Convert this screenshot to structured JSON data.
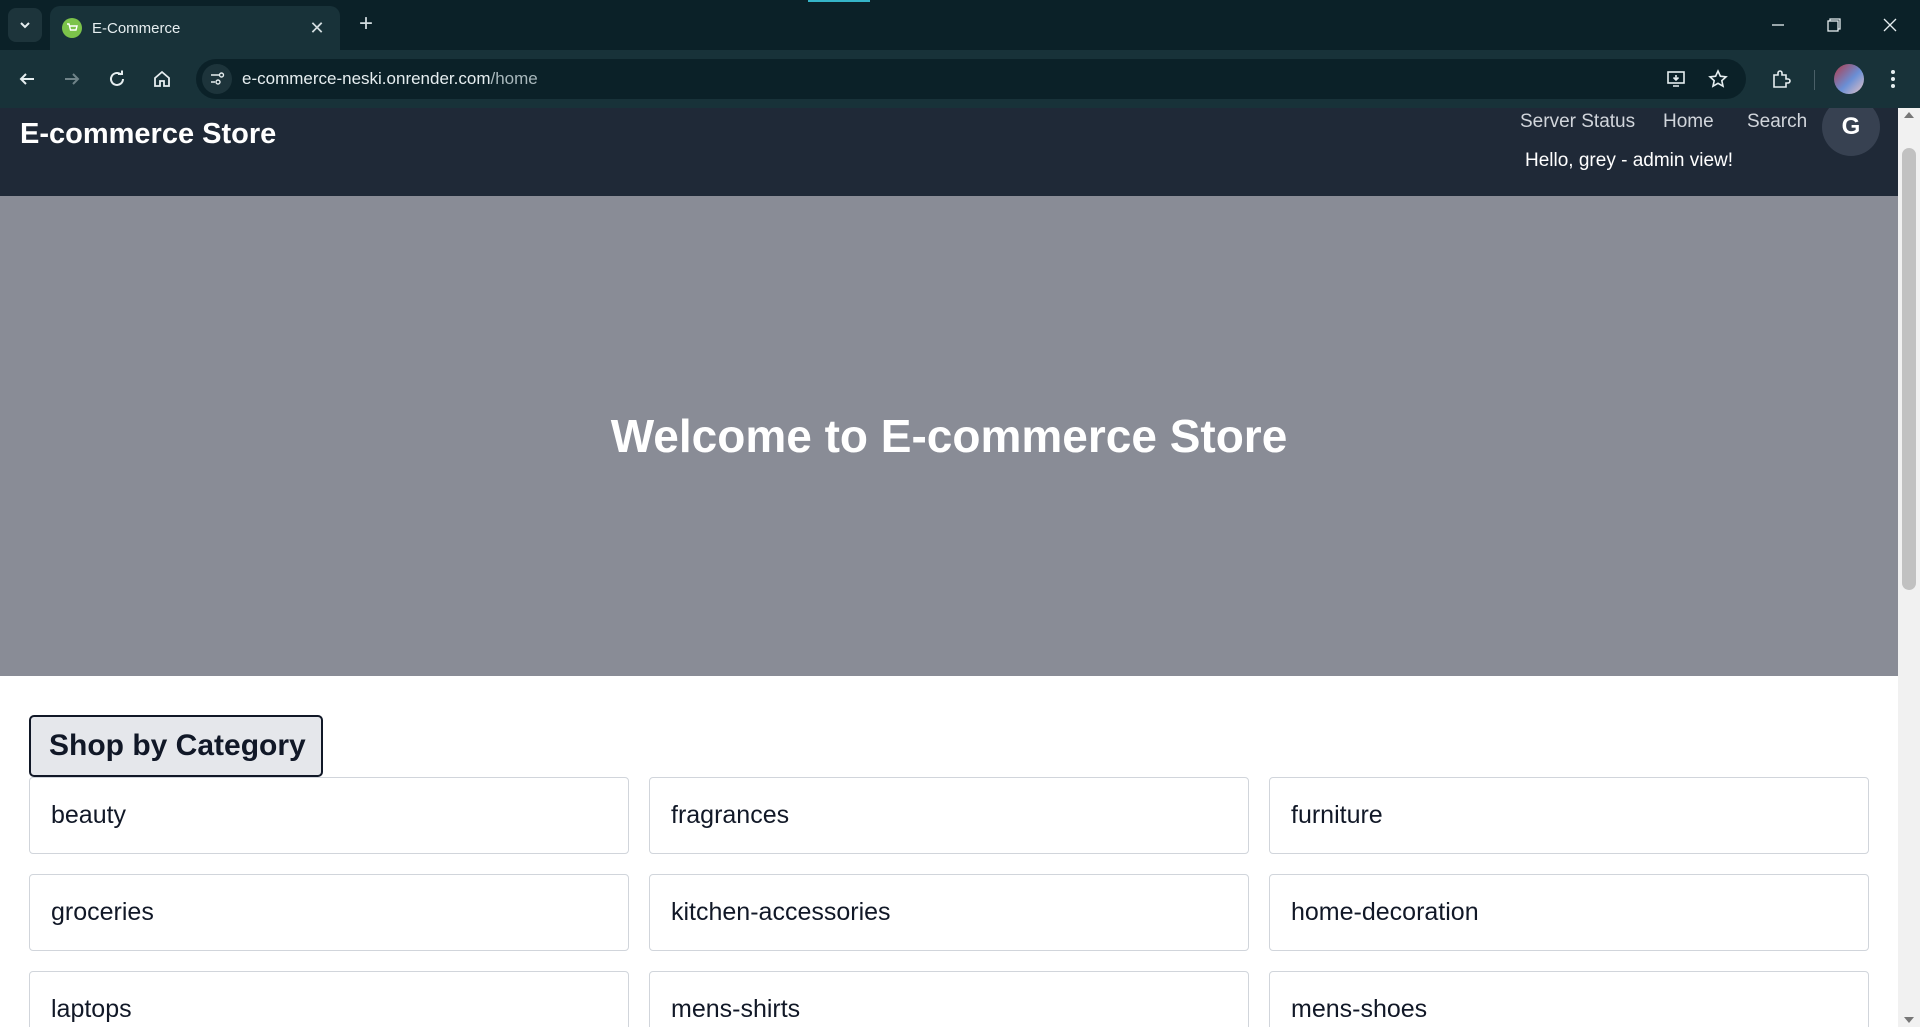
{
  "browser": {
    "tab_title": "E-Commerce",
    "url_domain": "e-commerce-neski.onrender.com",
    "url_path": "/home"
  },
  "site": {
    "brand": "E-commerce Store",
    "nav": {
      "server_status": "Server Status",
      "home": "Home",
      "search": "Search"
    },
    "avatar_initial": "G",
    "greeting": "Hello, grey - admin view!"
  },
  "hero": {
    "title": "Welcome to E-commerce Store"
  },
  "categories": {
    "heading": "Shop by Category",
    "items": [
      {
        "label": "beauty"
      },
      {
        "label": "fragrances"
      },
      {
        "label": "furniture"
      },
      {
        "label": "groceries"
      },
      {
        "label": "kitchen-accessories"
      },
      {
        "label": "home-decoration"
      },
      {
        "label": "laptops"
      },
      {
        "label": "mens-shirts"
      },
      {
        "label": "mens-shoes"
      }
    ]
  },
  "colors": {
    "browser_frame": "#0b2128",
    "browser_toolbar": "#183239",
    "header_bg": "#1f2937",
    "hero_bg": "#898c96"
  },
  "icons": [
    "tab-search-icon",
    "shopping-cart-icon",
    "close-icon",
    "plus-icon",
    "minimize-icon",
    "restore-icon",
    "back-arrow-icon",
    "forward-arrow-icon",
    "reload-icon",
    "home-icon",
    "site-info-icon",
    "install-app-icon",
    "star-icon",
    "extensions-icon",
    "more-vertical-icon"
  ]
}
